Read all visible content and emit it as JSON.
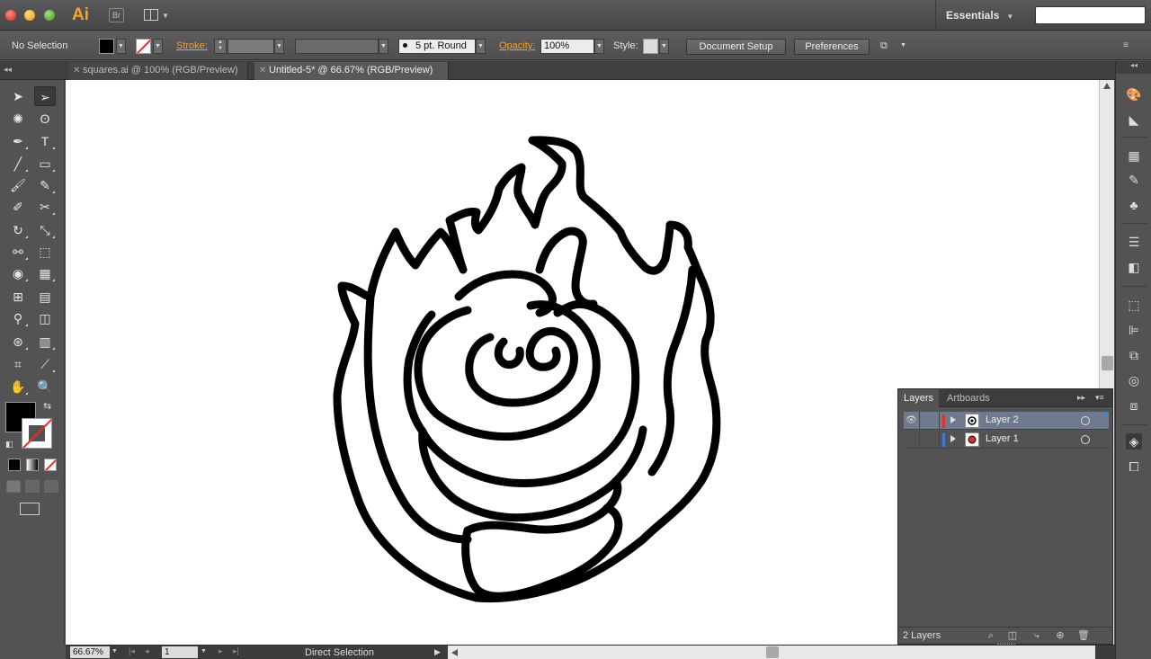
{
  "app": {
    "logo": "Ai",
    "bridge_label": "Br",
    "workspace": "Essentials",
    "search_placeholder": ""
  },
  "control_bar": {
    "selection": "No Selection",
    "stroke_label": "Stroke:",
    "brush": "5 pt. Round",
    "opacity_label": "Opacity:",
    "opacity_value": "100%",
    "style_label": "Style:",
    "document_setup": "Document Setup",
    "preferences": "Preferences"
  },
  "tabs": [
    {
      "label": "squares.ai @ 100% (RGB/Preview)",
      "active": false
    },
    {
      "label": "Untitled-5* @ 66.67% (RGB/Preview)",
      "active": true
    }
  ],
  "tools": [
    {
      "name": "selection-tool",
      "icon": "arrow"
    },
    {
      "name": "direct-selection-tool",
      "icon": "white-arrow",
      "selected": true
    },
    {
      "name": "magic-wand-tool",
      "icon": "magic-wand"
    },
    {
      "name": "lasso-tool",
      "icon": "lasso"
    },
    {
      "name": "pen-tool",
      "icon": "pen"
    },
    {
      "name": "type-tool",
      "icon": "T"
    },
    {
      "name": "line-segment-tool",
      "icon": "line"
    },
    {
      "name": "rectangle-tool",
      "icon": "rectangle"
    },
    {
      "name": "paintbrush-tool",
      "icon": "brush"
    },
    {
      "name": "pencil-tool",
      "icon": "pencil"
    },
    {
      "name": "blob-brush-tool",
      "icon": "blob-brush"
    },
    {
      "name": "scissors-tool",
      "icon": "scissors"
    },
    {
      "name": "rotate-tool",
      "icon": "rotate"
    },
    {
      "name": "scale-tool",
      "icon": "scale"
    },
    {
      "name": "width-tool",
      "icon": "width"
    },
    {
      "name": "free-transform-tool",
      "icon": "free-transform"
    },
    {
      "name": "shape-builder-tool",
      "icon": "shape-builder"
    },
    {
      "name": "perspective-grid-tool",
      "icon": "perspective-grid"
    },
    {
      "name": "mesh-tool",
      "icon": "mesh"
    },
    {
      "name": "gradient-tool",
      "icon": "gradient"
    },
    {
      "name": "eyedropper-tool",
      "icon": "eyedropper"
    },
    {
      "name": "blend-tool",
      "icon": "blend"
    },
    {
      "name": "symbol-sprayer-tool",
      "icon": "symbol-sprayer"
    },
    {
      "name": "column-graph-tool",
      "icon": "column-graph"
    },
    {
      "name": "artboard-tool",
      "icon": "artboard"
    },
    {
      "name": "slice-tool",
      "icon": "slice"
    },
    {
      "name": "hand-tool",
      "icon": "hand"
    },
    {
      "name": "zoom-tool",
      "icon": "zoom"
    }
  ],
  "colors": {
    "fill": "#000000",
    "stroke": "none",
    "layer2_color": "#e0302a",
    "layer1_color": "#3f7bd6",
    "selection_highlight": "#6e7a8e"
  },
  "status_bar": {
    "zoom": "66.67%",
    "artboard": "1",
    "current_tool": "Direct Selection"
  },
  "layers_panel": {
    "tabs": [
      "Layers",
      "Artboards"
    ],
    "layers": [
      {
        "name": "Layer 2",
        "visible": true,
        "selected": true
      },
      {
        "name": "Layer 1",
        "visible": false,
        "selected": false
      }
    ],
    "count_label": "2 Layers"
  }
}
